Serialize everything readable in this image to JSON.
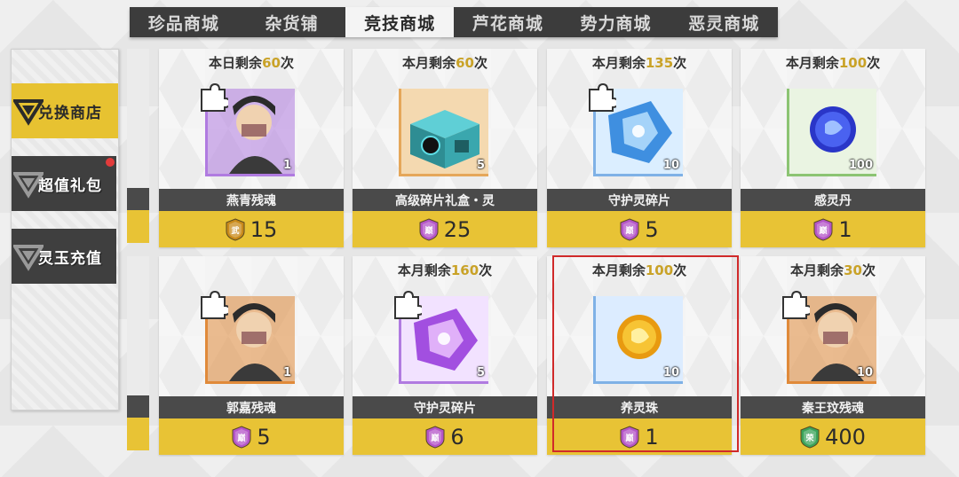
{
  "tabs": [
    {
      "label": "珍品商城"
    },
    {
      "label": "杂货铺"
    },
    {
      "label": "竞技商城",
      "active": true
    },
    {
      "label": "芦花商城"
    },
    {
      "label": "势力商城"
    },
    {
      "label": "恶灵商城"
    }
  ],
  "sidebar": {
    "items": [
      {
        "label": "兑换商店",
        "active": true
      },
      {
        "label": "超值礼包",
        "badge": true
      },
      {
        "label": "灵玉充值"
      }
    ]
  },
  "shop": {
    "items": [
      {
        "limit_prefix": "本日剩余",
        "limit_count": "60",
        "limit_suffix": "次",
        "name": "燕青残魂",
        "qty": "1",
        "price": "15",
        "currency": "武",
        "currency_color": "#c98a1a",
        "frame_color": "#b07be0",
        "icon": "character-portrait-icon"
      },
      {
        "limit_prefix": "本月剩余",
        "limit_count": "60",
        "limit_suffix": "次",
        "name": "高级碎片礼盒・灵",
        "qty": "5",
        "price": "25",
        "currency": "巅",
        "currency_color": "#b455c8",
        "frame_color": "#e5a75a",
        "icon": "gift-box-icon"
      },
      {
        "limit_prefix": "本月剩余",
        "limit_count": "135",
        "limit_suffix": "次",
        "name": "守护灵碎片",
        "qty": "10",
        "price": "5",
        "currency": "巅",
        "currency_color": "#b455c8",
        "frame_color": "#7fb1e6",
        "icon": "blue-shard-icon"
      },
      {
        "limit_prefix": "本月剩余",
        "limit_count": "100",
        "limit_suffix": "次",
        "name": "感灵丹",
        "qty": "100",
        "price": "1",
        "currency": "巅",
        "currency_color": "#b455c8",
        "frame_color": "#8cc473",
        "icon": "blue-orb-icon"
      },
      {
        "limit_prefix": "",
        "limit_count": "",
        "limit_suffix": "",
        "name": "郭嘉残魂",
        "qty": "1",
        "price": "5",
        "currency": "巅",
        "currency_color": "#b455c8",
        "frame_color": "#e08a3a",
        "icon": "character-portrait-icon"
      },
      {
        "limit_prefix": "本月剩余",
        "limit_count": "160",
        "limit_suffix": "次",
        "name": "守护灵碎片",
        "qty": "5",
        "price": "6",
        "currency": "巅",
        "currency_color": "#b455c8",
        "frame_color": "#b07be0",
        "icon": "purple-shard-icon"
      },
      {
        "limit_prefix": "本月剩余",
        "limit_count": "100",
        "limit_suffix": "次",
        "name": "养灵珠",
        "qty": "10",
        "price": "1",
        "currency": "巅",
        "currency_color": "#b455c8",
        "frame_color": "#7fb1e6",
        "icon": "gold-orb-icon"
      },
      {
        "limit_prefix": "本月剩余",
        "limit_count": "30",
        "limit_suffix": "次",
        "name": "秦王玟残魂",
        "qty": "10",
        "price": "400",
        "currency": "荣",
        "currency_color": "#3aa35a",
        "frame_color": "#e08a3a",
        "icon": "character-portrait-icon"
      }
    ]
  },
  "colors": {
    "accent_yellow": "#e8c335",
    "dark_bar": "#4a4a4a",
    "highlight_red": "#d02a2a"
  }
}
